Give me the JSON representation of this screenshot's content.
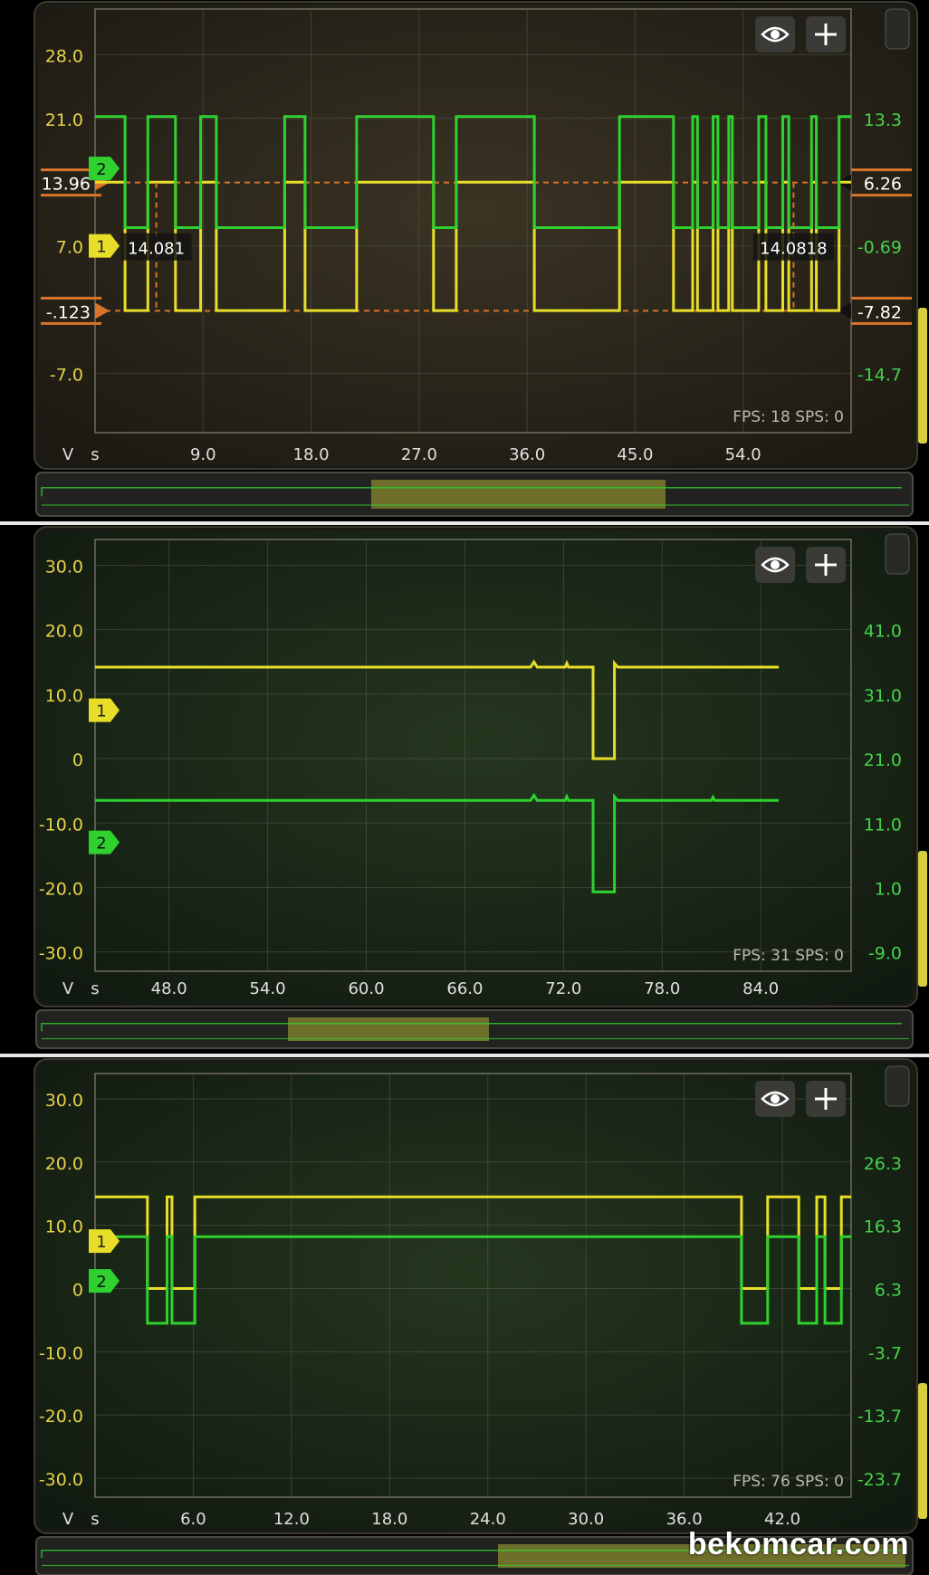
{
  "colors": {
    "ch1": "#e8de2a",
    "ch2": "#2fd12f",
    "left_axis_text": "#e6d24a",
    "right_axis_text": "#45d24a",
    "marker": "#d9742a"
  },
  "icons": {
    "visibility": "eye-icon",
    "add": "plus-icon"
  },
  "watermark": "bekomcar.com",
  "panels": [
    {
      "left_ticks": [
        {
          "label": "28.0",
          "value": 28
        },
        {
          "label": "21.0",
          "value": 21
        },
        {
          "label": "7.0",
          "value": 7
        },
        {
          "label": "-7.0",
          "value": -7
        }
      ],
      "right_ticks": [
        {
          "label": "13.3",
          "value": 21
        },
        {
          "label": "-0.69",
          "value": 7
        },
        {
          "label": "-14.7",
          "value": -7
        }
      ],
      "x_ticks": [
        {
          "label": "9.0",
          "value": 9
        },
        {
          "label": "18.0",
          "value": 18
        },
        {
          "label": "27.0",
          "value": 27
        },
        {
          "label": "36.0",
          "value": 36
        },
        {
          "label": "45.0",
          "value": 45
        },
        {
          "label": "54.0",
          "value": 54
        }
      ],
      "x_range": [
        0,
        63
      ],
      "y_range": [
        -13.5,
        33
      ],
      "y_unit": "V",
      "x_unit": "s",
      "status": "FPS: 18  SPS: 0",
      "channel_markers": [
        {
          "id": "1",
          "label": "1",
          "channel": "ch1",
          "value": 7
        },
        {
          "id": "2",
          "label": "2",
          "channel": "ch2",
          "value": 15.5
        }
      ],
      "cursors": {
        "horizontal": [
          {
            "left_label": "13.96",
            "right_label": "6.26",
            "value": 13.96
          },
          {
            "left_label": "-.123",
            "right_label": "-7.82",
            "value": -0.123
          }
        ],
        "vertical": [
          {
            "label": "14.081",
            "x": 5.1
          },
          {
            "label": "14.0818",
            "x": 58.2
          }
        ]
      },
      "series": [
        {
          "channel": "ch1",
          "high": 14,
          "low": -0.1,
          "segments": [
            [
              0,
              2.5,
              "high"
            ],
            [
              2.5,
              4.4,
              "low"
            ],
            [
              4.4,
              6.7,
              "high"
            ],
            [
              6.7,
              8.8,
              "low"
            ],
            [
              8.8,
              10.1,
              "high"
            ],
            [
              10.1,
              15.8,
              "low"
            ],
            [
              15.8,
              17.5,
              "high"
            ],
            [
              17.5,
              21.8,
              "low"
            ],
            [
              21.8,
              28.2,
              "high"
            ],
            [
              28.2,
              30.1,
              "low"
            ],
            [
              30.1,
              36.6,
              "high"
            ],
            [
              36.6,
              43.7,
              "low"
            ],
            [
              43.7,
              48.2,
              "high"
            ],
            [
              48.2,
              49.8,
              "low"
            ],
            [
              49.8,
              50.2,
              "high"
            ],
            [
              50.2,
              51.5,
              "low"
            ],
            [
              51.5,
              51.9,
              "high"
            ],
            [
              51.9,
              52.8,
              "low"
            ],
            [
              52.8,
              53.1,
              "high"
            ],
            [
              53.1,
              55.3,
              "low"
            ],
            [
              55.3,
              55.9,
              "high"
            ],
            [
              55.9,
              57.3,
              "low"
            ],
            [
              57.3,
              57.8,
              "high"
            ],
            [
              57.8,
              59.7,
              "low"
            ],
            [
              59.7,
              60.1,
              "high"
            ],
            [
              60.1,
              62.0,
              "low"
            ],
            [
              62.0,
              63,
              "high"
            ]
          ]
        },
        {
          "channel": "ch2",
          "high": 21.2,
          "low": 9,
          "segments": [
            [
              0,
              2.5,
              "high"
            ],
            [
              2.5,
              4.4,
              "low"
            ],
            [
              4.4,
              6.7,
              "high"
            ],
            [
              6.7,
              8.8,
              "low"
            ],
            [
              8.8,
              10.1,
              "high"
            ],
            [
              10.1,
              15.8,
              "low"
            ],
            [
              15.8,
              17.5,
              "high"
            ],
            [
              17.5,
              21.8,
              "low"
            ],
            [
              21.8,
              28.2,
              "high"
            ],
            [
              28.2,
              30.1,
              "low"
            ],
            [
              30.1,
              36.6,
              "high"
            ],
            [
              36.6,
              43.7,
              "low"
            ],
            [
              43.7,
              48.2,
              "high"
            ],
            [
              48.2,
              49.8,
              "low"
            ],
            [
              49.8,
              50.2,
              "high"
            ],
            [
              50.2,
              51.5,
              "low"
            ],
            [
              51.5,
              51.9,
              "high"
            ],
            [
              51.9,
              52.8,
              "low"
            ],
            [
              52.8,
              53.1,
              "high"
            ],
            [
              53.1,
              55.3,
              "low"
            ],
            [
              55.3,
              55.9,
              "high"
            ],
            [
              55.9,
              57.3,
              "low"
            ],
            [
              57.3,
              57.8,
              "high"
            ],
            [
              57.8,
              59.7,
              "low"
            ],
            [
              59.7,
              60.1,
              "high"
            ],
            [
              60.1,
              62.0,
              "low"
            ],
            [
              62.0,
              63,
              "high"
            ]
          ]
        }
      ]
    },
    {
      "left_ticks": [
        {
          "label": "30.0",
          "value": 30
        },
        {
          "label": "20.0",
          "value": 20
        },
        {
          "label": "10.0",
          "value": 10
        },
        {
          "label": "0",
          "value": 0
        },
        {
          "label": "-10.0",
          "value": -10
        },
        {
          "label": "-20.0",
          "value": -20
        },
        {
          "label": "-30.0",
          "value": -30
        }
      ],
      "right_ticks": [
        {
          "label": "41.0",
          "value": 20
        },
        {
          "label": "31.0",
          "value": 10
        },
        {
          "label": "21.0",
          "value": 0
        },
        {
          "label": "11.0",
          "value": -10
        },
        {
          "label": "1.0",
          "value": -20
        },
        {
          "label": "-9.0",
          "value": -30
        }
      ],
      "x_ticks": [
        {
          "label": "48.0",
          "value": 48
        },
        {
          "label": "54.0",
          "value": 54
        },
        {
          "label": "60.0",
          "value": 60
        },
        {
          "label": "66.0",
          "value": 66
        },
        {
          "label": "72.0",
          "value": 72
        },
        {
          "label": "78.0",
          "value": 78
        },
        {
          "label": "84.0",
          "value": 84
        }
      ],
      "x_range": [
        43.5,
        89.5
      ],
      "y_range": [
        -33,
        34
      ],
      "y_unit": "V",
      "x_unit": "s",
      "status": "FPS: 31  SPS: 0",
      "channel_markers": [
        {
          "id": "1",
          "label": "1",
          "channel": "ch1",
          "value": 7.5
        },
        {
          "id": "2",
          "label": "2",
          "channel": "ch2",
          "value": -13
        }
      ],
      "series": [
        {
          "channel": "ch1",
          "points": [
            [
              43.5,
              14.2
            ],
            [
              70.0,
              14.2
            ],
            [
              70.2,
              15.0
            ],
            [
              70.4,
              14.2
            ],
            [
              72.1,
              14.2
            ],
            [
              72.2,
              14.8
            ],
            [
              72.3,
              14.2
            ],
            [
              73.8,
              14.2
            ],
            [
              73.8,
              0
            ],
            [
              75.1,
              0
            ],
            [
              75.1,
              14.8
            ],
            [
              75.3,
              14.2
            ],
            [
              85.1,
              14.2
            ]
          ]
        },
        {
          "channel": "ch2",
          "points": [
            [
              43.5,
              -6.5
            ],
            [
              70.0,
              -6.5
            ],
            [
              70.2,
              -5.7
            ],
            [
              70.4,
              -6.5
            ],
            [
              72.1,
              -6.5
            ],
            [
              72.2,
              -5.9
            ],
            [
              72.3,
              -6.5
            ],
            [
              73.8,
              -6.5
            ],
            [
              73.8,
              -20.7
            ],
            [
              75.1,
              -20.7
            ],
            [
              75.1,
              -5.9
            ],
            [
              75.3,
              -6.5
            ],
            [
              81.0,
              -6.5
            ],
            [
              81.1,
              -6.0
            ],
            [
              81.2,
              -6.5
            ],
            [
              85.1,
              -6.5
            ]
          ]
        }
      ]
    },
    {
      "left_ticks": [
        {
          "label": "30.0",
          "value": 30
        },
        {
          "label": "20.0",
          "value": 20
        },
        {
          "label": "10.0",
          "value": 10
        },
        {
          "label": "0",
          "value": 0
        },
        {
          "label": "-10.0",
          "value": -10
        },
        {
          "label": "-20.0",
          "value": -20
        },
        {
          "label": "-30.0",
          "value": -30
        }
      ],
      "right_ticks": [
        {
          "label": "26.3",
          "value": 20
        },
        {
          "label": "16.3",
          "value": 10
        },
        {
          "label": "6.3",
          "value": 0
        },
        {
          "label": "-3.7",
          "value": -10
        },
        {
          "label": "-13.7",
          "value": -20
        },
        {
          "label": "-23.7",
          "value": -30
        }
      ],
      "x_ticks": [
        {
          "label": "6.0",
          "value": 6
        },
        {
          "label": "12.0",
          "value": 12
        },
        {
          "label": "18.0",
          "value": 18
        },
        {
          "label": "24.0",
          "value": 24
        },
        {
          "label": "30.0",
          "value": 30
        },
        {
          "label": "36.0",
          "value": 36
        },
        {
          "label": "42.0",
          "value": 42
        }
      ],
      "x_range": [
        0,
        46.2
      ],
      "y_range": [
        -33,
        34
      ],
      "y_unit": "V",
      "x_unit": "s",
      "status": "FPS: 76  SPS: 0",
      "channel_markers": [
        {
          "id": "1",
          "label": "1",
          "channel": "ch1",
          "value": 7.5
        },
        {
          "id": "2",
          "label": "2",
          "channel": "ch2",
          "value": 1.2
        }
      ],
      "series": [
        {
          "channel": "ch1",
          "high": 14.5,
          "low": 0,
          "segments": [
            [
              0,
              3.2,
              "high"
            ],
            [
              3.2,
              4.4,
              "low"
            ],
            [
              4.4,
              4.7,
              "high"
            ],
            [
              4.7,
              6.1,
              "low"
            ],
            [
              6.1,
              39.5,
              "high"
            ],
            [
              39.5,
              41.1,
              "low"
            ],
            [
              41.1,
              43.0,
              "high"
            ],
            [
              43.0,
              44.1,
              "low"
            ],
            [
              44.1,
              44.6,
              "high"
            ],
            [
              44.6,
              45.6,
              "low"
            ],
            [
              45.6,
              46.2,
              "high"
            ]
          ]
        },
        {
          "channel": "ch2",
          "high": 8.2,
          "low": -5.5,
          "segments": [
            [
              0,
              3.2,
              "high"
            ],
            [
              3.2,
              4.4,
              "low"
            ],
            [
              4.4,
              4.7,
              "high"
            ],
            [
              4.7,
              6.1,
              "low"
            ],
            [
              6.1,
              39.5,
              "high"
            ],
            [
              39.5,
              41.1,
              "low"
            ],
            [
              41.1,
              43.0,
              "high"
            ],
            [
              43.0,
              44.1,
              "low"
            ],
            [
              44.1,
              44.6,
              "high"
            ],
            [
              44.6,
              45.6,
              "low"
            ],
            [
              45.6,
              46.2,
              "high"
            ]
          ]
        }
      ]
    }
  ]
}
